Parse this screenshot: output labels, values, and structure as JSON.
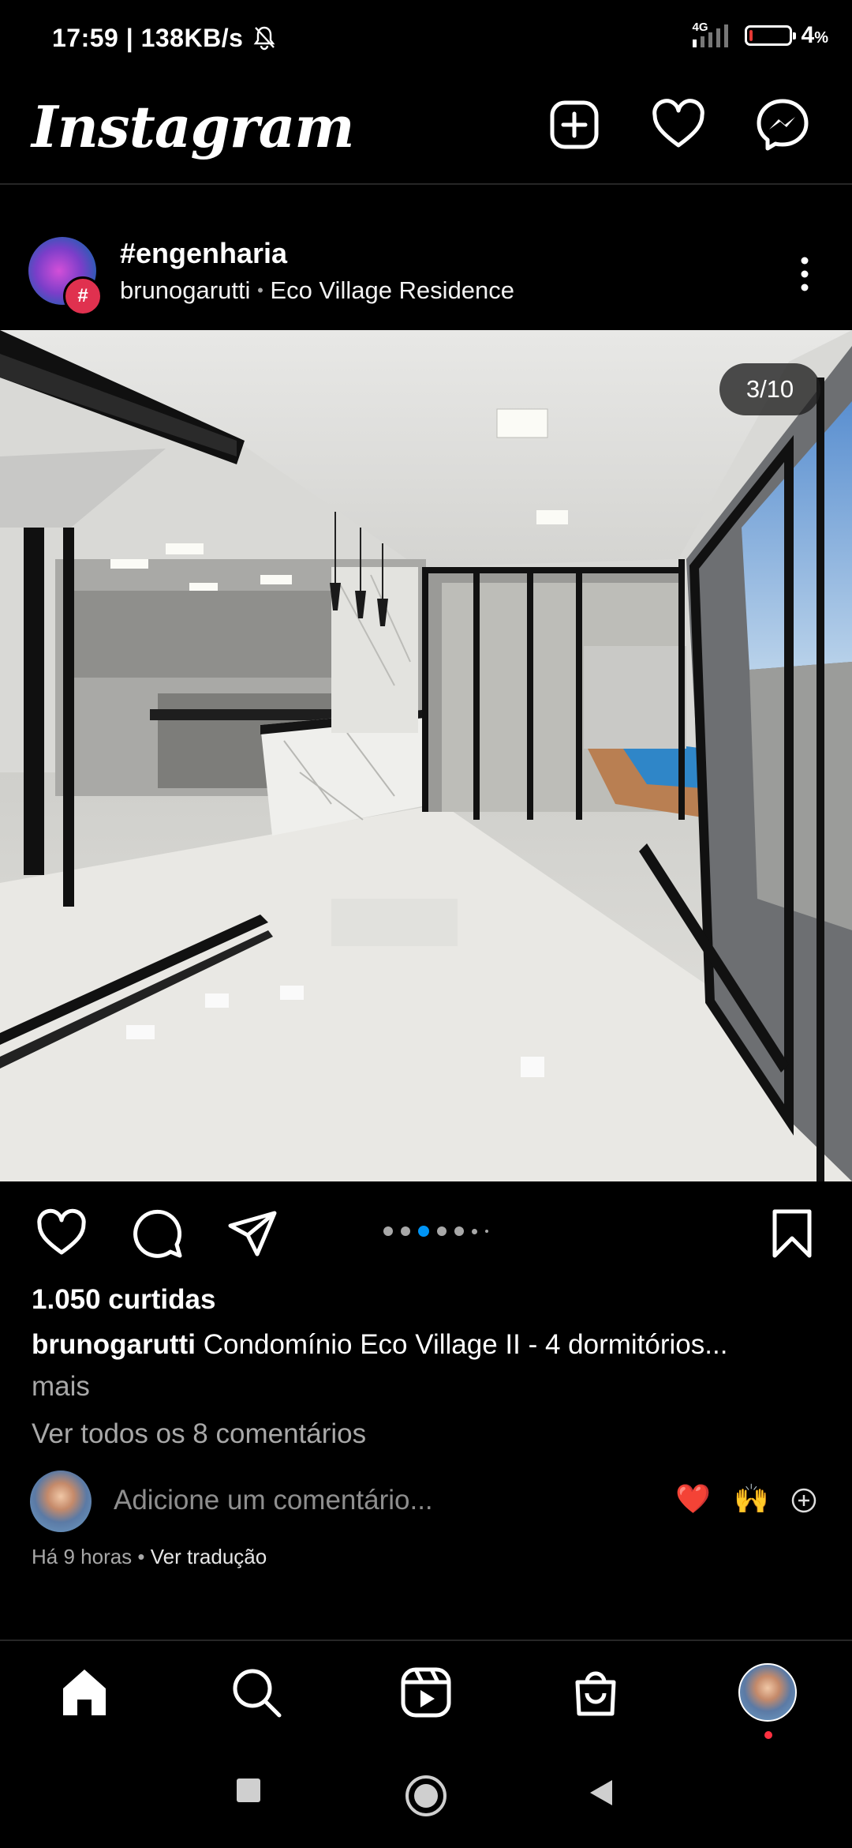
{
  "status_bar": {
    "time": "17:59",
    "speed": "| 138KB/s",
    "network": "4G",
    "battery": "4",
    "battery_unit": "%"
  },
  "header": {
    "app_name": "Instagram",
    "icons": [
      "plus-square-icon",
      "heart-icon",
      "messenger-icon"
    ]
  },
  "post": {
    "title": "#engenharia",
    "author": "brunogarutti",
    "location": "Eco Village Residence",
    "separator": "•",
    "image_counter": "3/10",
    "carousel": {
      "total_indicators": 7,
      "active_index": 2
    },
    "likes": "1.050 curtidas",
    "caption_user": "brunogarutti",
    "caption_text": "Condomínio Eco Village II - 4 dormitórios...",
    "caption_more": "mais",
    "view_comments": "Ver todos os 8 comentários",
    "add_comment_placeholder": "Adicione um comentário...",
    "quick_reactions": [
      "❤️",
      "🙌"
    ],
    "time_ago": "Há 9 horas",
    "translate": "Ver tradução"
  },
  "bottom_nav": {
    "items": [
      "home-icon",
      "search-icon",
      "reels-icon",
      "shop-icon",
      "profile-avatar"
    ]
  },
  "colors": {
    "background": "#000000",
    "accent_blue": "#0095f6",
    "notification_red": "#ff3040",
    "secondary_text": "#a8a8a8"
  }
}
